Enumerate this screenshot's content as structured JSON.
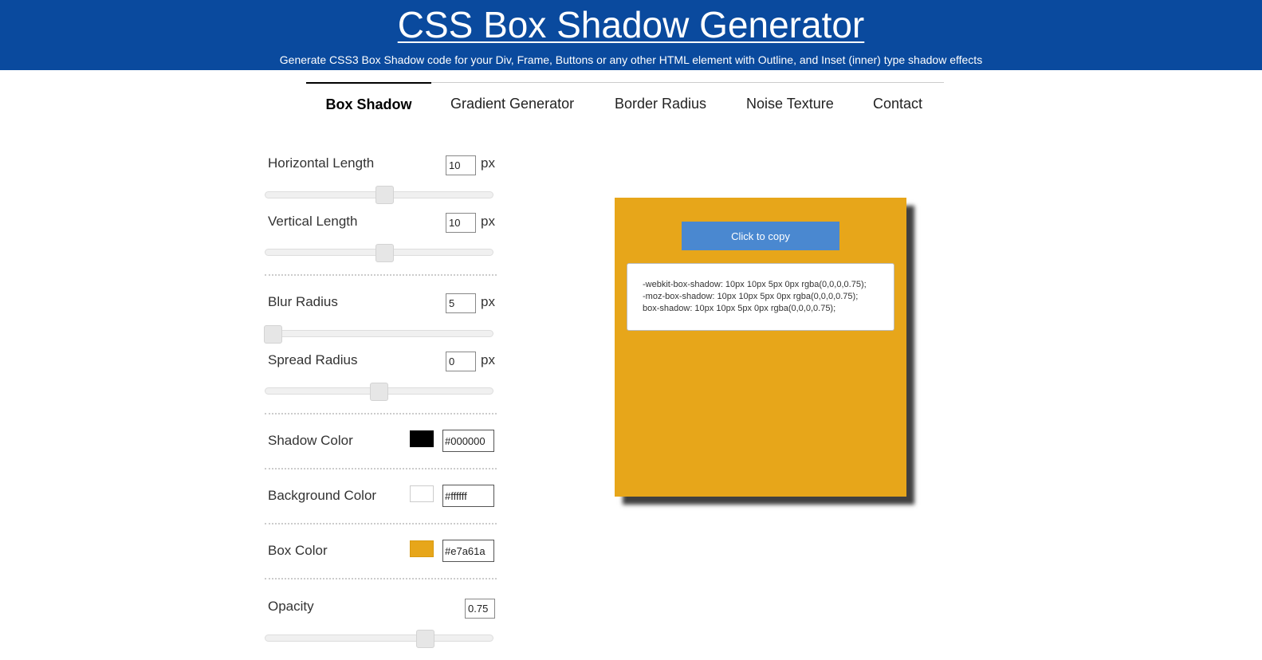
{
  "header": {
    "title": "CSS Box Shadow Generator",
    "subtitle": "Generate CSS3 Box Shadow code for your Div, Frame, Buttons or any other HTML element with Outline, and Inset (inner) type shadow effects",
    "bg_color": "#0a4a9e"
  },
  "nav": {
    "tabs": [
      {
        "label": "Box Shadow",
        "active": true
      },
      {
        "label": "Gradient Generator",
        "active": false
      },
      {
        "label": "Border Radius",
        "active": false
      },
      {
        "label": "Noise Texture",
        "active": false
      },
      {
        "label": "Contact",
        "active": false
      }
    ]
  },
  "controls": {
    "horizontal": {
      "label": "Horizontal Length",
      "value": "10",
      "unit": "px"
    },
    "vertical": {
      "label": "Vertical Length",
      "value": "10",
      "unit": "px"
    },
    "blur": {
      "label": "Blur Radius",
      "value": "5",
      "unit": "px"
    },
    "spread": {
      "label": "Spread Radius",
      "value": "0",
      "unit": "px"
    },
    "shadow_color": {
      "label": "Shadow Color",
      "value": "#000000",
      "swatch": "#000000"
    },
    "background_color": {
      "label": "Background Color",
      "value": "#ffffff",
      "swatch": "#ffffff"
    },
    "box_color": {
      "label": "Box Color",
      "value": "#e7a61a",
      "swatch": "#e7a61a"
    },
    "opacity": {
      "label": "Opacity",
      "value": "0.75"
    }
  },
  "preview": {
    "box_color": "#e7a61a",
    "copy_button": "Click to copy",
    "code_lines": [
      "-webkit-box-shadow: 10px 10px 5px 0px rgba(0,0,0,0.75);",
      "-moz-box-shadow: 10px 10px 5px 0px rgba(0,0,0,0.75);",
      "box-shadow: 10px 10px 5px 0px rgba(0,0,0,0.75);"
    ]
  },
  "colors": {
    "accent_blue": "#4a88d0"
  }
}
